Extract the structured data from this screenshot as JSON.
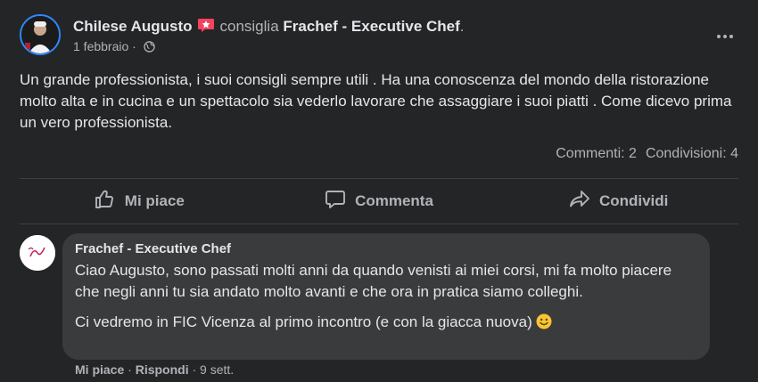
{
  "post": {
    "author": "Chilese Augusto",
    "verb": "consiglia",
    "page": "Frachef - Executive Chef",
    "page_suffix": ".",
    "date": "1 febbraio",
    "dot": "·",
    "text": "Un grande professionista, i suoi consigli sempre utili . Ha una conoscenza del mondo della ristorazione molto alta e in cucina e un spettacolo  sia vederlo lavorare che assaggiare i suoi piatti  . Come dicevo prima un vero professionista.",
    "privacy_icon": "globe-icon",
    "recommend_icon": "recommend-star-icon"
  },
  "stats": {
    "comments": "Commenti: 2",
    "shares": "Condivisioni: 4"
  },
  "actions": {
    "like": "Mi piace",
    "comment": "Commenta",
    "share": "Condividi"
  },
  "comment": {
    "author": "Frachef - Executive Chef",
    "text1": "Ciao Augusto, sono passati molti anni da quando venisti ai miei corsi, mi fa molto piacere che negli anni tu sia andato molto avanti e che ora in pratica siamo colleghi.",
    "text2": "Ci vedremo in FIC Vicenza al primo incontro (e con la giacca nuova)",
    "emoji": "smile-emoji",
    "like": "Mi piace",
    "reply": "Rispondi",
    "time": "9 sett.",
    "dot": "·"
  },
  "colors": {
    "background": "#242526",
    "bubble": "#3a3b3c",
    "text": "#e4e6eb",
    "secondary": "#b0b3b8",
    "recommend": "#f3425f",
    "avatar_ring": "#2d88ff"
  }
}
